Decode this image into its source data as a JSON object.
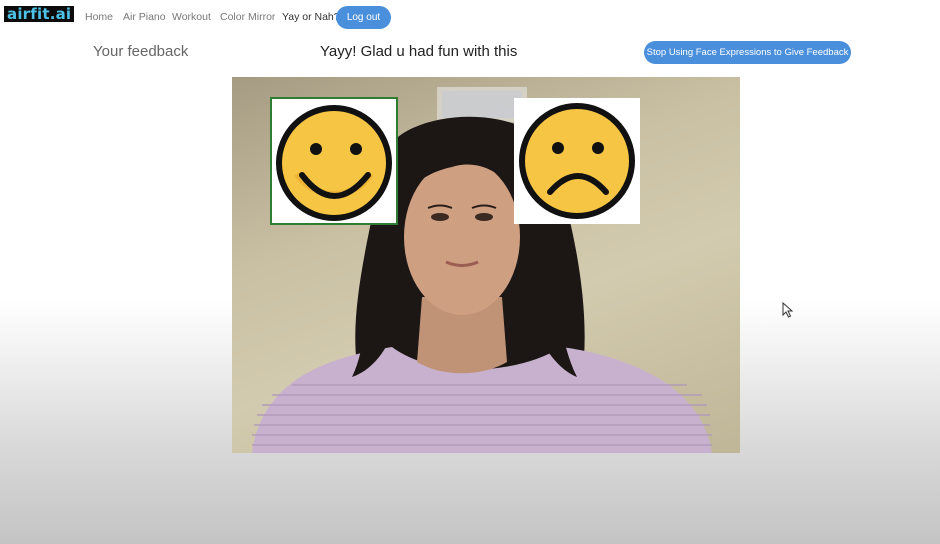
{
  "nav": {
    "brand_a": "airfit",
    "brand_b": ".ai",
    "links": [
      {
        "label": "Home"
      },
      {
        "label": "Air Piano"
      },
      {
        "label": "Workout"
      },
      {
        "label": "Color Mirror"
      },
      {
        "label": "Yay or Nah?"
      }
    ],
    "logout_label": "Log out"
  },
  "feedback": {
    "label": "Your feedback",
    "message": "Yayy! Glad u had fun with this",
    "stop_button_label": "Stop Using Face Expressions to Give Feedback"
  },
  "video": {
    "options": [
      {
        "icon": "happy-face-icon",
        "selected": true
      },
      {
        "icon": "sad-face-icon",
        "selected": false
      }
    ]
  },
  "colors": {
    "accent": "#4a8fdc",
    "selected_border": "#2e7d32",
    "emoji_yellow": "#f6c543"
  }
}
